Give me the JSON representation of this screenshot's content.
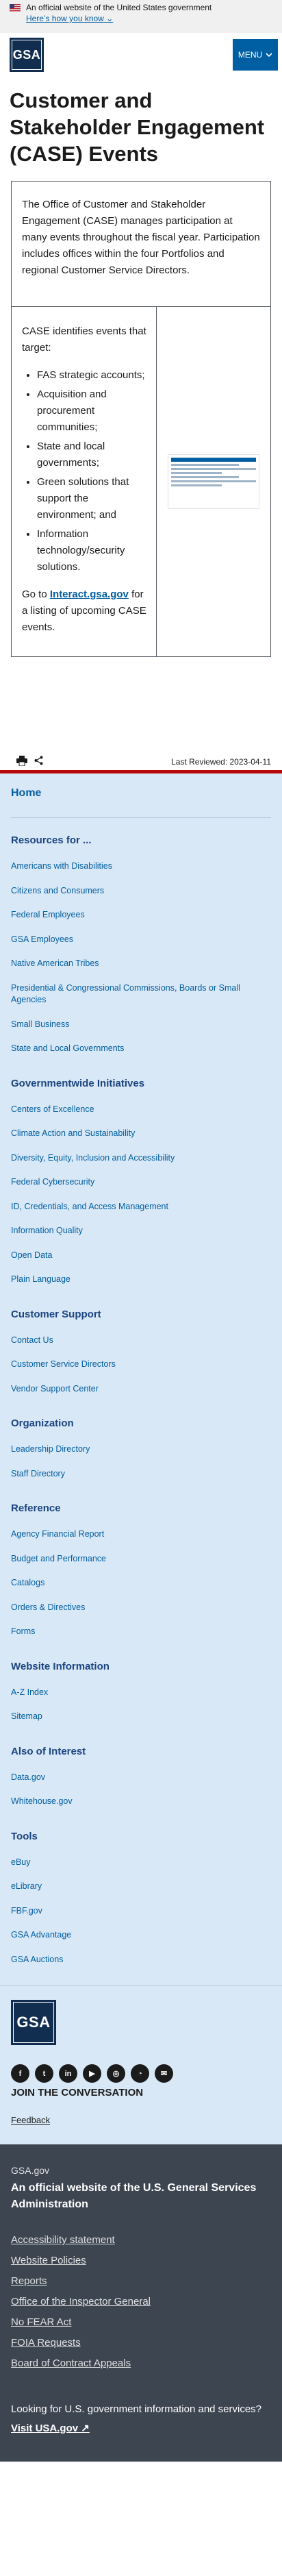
{
  "banner": {
    "text": "An official website of the United States government",
    "how_link": "Here’s how you know"
  },
  "header": {
    "logo": "GSA",
    "menu_label": "MENU"
  },
  "page": {
    "title": "Customer and Stakeholder Engagement (CASE) Events",
    "intro": "The Office of Customer and Stakeholder Engagement (CASE) manages participation at many events throughout the fiscal year. Participation includes offices within the four Portfolios and regional Customer Service Directors.",
    "targets_intro": "CASE identifies events that target:",
    "targets": [
      "FAS strategic accounts;",
      "Acquisition and procurement communities;",
      "State and local governments;",
      "Green solutions that support the environment; and",
      "Information technology/security solutions."
    ],
    "goto_prefix": "Go to ",
    "goto_link": "Interact.gsa.gov",
    "goto_suffix": " for a listing of upcoming CASE events."
  },
  "reviewed": {
    "text": "Last Reviewed: 2023-04-11"
  },
  "footer_nav": {
    "home": "Home",
    "sections": [
      {
        "heading": "Resources for ...",
        "links": [
          "Americans with Disabilities",
          "Citizens and Consumers",
          "Federal Employees",
          "GSA Employees",
          "Native American Tribes",
          "Presidential & Congressional Commissions, Boards or Small Agencies",
          "Small Business",
          "State and Local Governments"
        ]
      },
      {
        "heading": "Governmentwide Initiatives",
        "links": [
          "Centers of Excellence",
          "Climate Action and Sustainability",
          "Diversity, Equity, Inclusion and Accessibility",
          "Federal Cybersecurity",
          "ID, Credentials, and Access Management",
          "Information Quality",
          "Open Data",
          "Plain Language"
        ]
      },
      {
        "heading": "Customer Support",
        "links": [
          "Contact Us",
          "Customer Service Directors",
          "Vendor Support Center"
        ]
      },
      {
        "heading": "Organization",
        "links": [
          "Leadership Directory",
          "Staff Directory"
        ]
      },
      {
        "heading": "Reference",
        "links": [
          "Agency Financial Report",
          "Budget and Performance",
          "Catalogs",
          "Orders & Directives",
          "Forms"
        ]
      },
      {
        "heading": "Website Information",
        "links": [
          "A-Z Index",
          "Sitemap"
        ]
      },
      {
        "heading": "Also of Interest",
        "links": [
          "Data.gov",
          "Whitehouse.gov"
        ]
      },
      {
        "heading": "Tools",
        "links": [
          "eBuy",
          "eLibrary",
          "FBF.gov",
          "GSA Advantage",
          "GSA Auctions"
        ]
      }
    ]
  },
  "social": {
    "logo": "GSA",
    "icons": [
      "facebook-icon",
      "twitter-icon",
      "linkedin-icon",
      "youtube-icon",
      "instagram-icon",
      "rss-icon",
      "email-icon"
    ],
    "join": "JOIN THE CONVERSATION",
    "feedback": "Feedback"
  },
  "dark_footer": {
    "site": "GSA.gov",
    "official": "An official website of the U.S. General Services Administration",
    "links": [
      "Accessibility statement",
      "Website Policies",
      "Reports",
      "Office of the Inspector General",
      "No FEAR Act",
      "FOIA Requests",
      "Board of Contract Appeals"
    ],
    "question": "Looking for U.S. government information and services?",
    "usa_link": "Visit USA.gov"
  },
  "colors": {
    "primary": "#005ea2",
    "navy": "#112e51",
    "footer_bg": "#d9e8f6",
    "dark_bg": "#3d4551",
    "accent_red": "#b50909"
  }
}
